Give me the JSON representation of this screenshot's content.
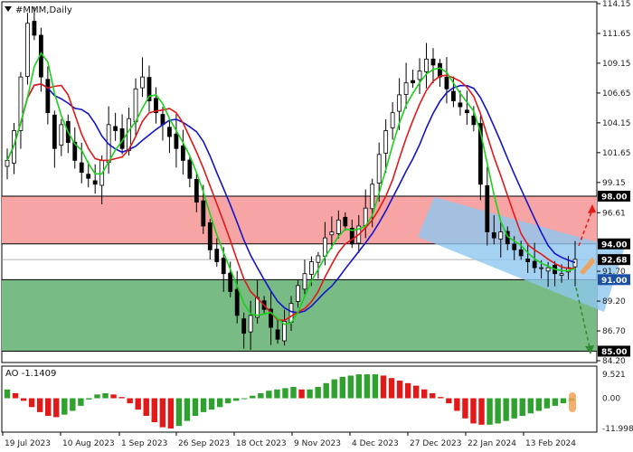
{
  "window": {
    "title": "#MMM,Daily",
    "collapse_icon": "triangle-down-icon"
  },
  "colors": {
    "bull": "#000000",
    "bear": "#000000",
    "ma_fast": "#19d219",
    "ma_mid": "#e11919",
    "ma_slow": "#1414c8",
    "zone_resistance": "#f7a4a4",
    "zone_support": "#78bb84",
    "channel": "#8fc7ef",
    "ao_up": "#2ea12e",
    "ao_down": "#e11919",
    "badge_black": "#000000",
    "badge_blue": "#1a4fa5",
    "marker_orange": "#f2a055"
  },
  "price_axis": {
    "labels": [
      "114.15",
      "111.65",
      "109.15",
      "106.65",
      "104.15",
      "101.65",
      "99.15",
      "96.61",
      "94.00",
      "92.68",
      "91.70",
      "91.00",
      "89.20",
      "86.70",
      "85.00",
      "84.20"
    ],
    "badges": [
      {
        "text": "98.00",
        "style": "black"
      },
      {
        "text": "94.00",
        "style": "black"
      },
      {
        "text": "92.68",
        "style": "black"
      },
      {
        "text": "91.00",
        "style": "blue"
      },
      {
        "text": "85.00",
        "style": "black"
      }
    ]
  },
  "levels": {
    "resistance_zone": [
      94.0,
      98.0
    ],
    "support_zone": [
      85.0,
      91.0
    ],
    "current": 92.68
  },
  "time_axis": {
    "labels": [
      "19 Jul 2023",
      "10 Aug 2023",
      "1 Sep 2023",
      "26 Sep 2023",
      "18 Oct 2023",
      "9 Nov 2023",
      "4 Dec 2023",
      "27 Dec 2023",
      "22 Jan 2024",
      "13 Feb 2024"
    ]
  },
  "ao_panel": {
    "title": "AO -1.1409",
    "axis": [
      "9.521",
      "0.00",
      "-11.998"
    ]
  },
  "chart_data": {
    "type": "candlestick",
    "symbol": "#MMM",
    "timeframe": "Daily",
    "close_path": [
      101.0,
      103.5,
      108.0,
      112.5,
      111.5,
      108.0,
      105.0,
      102.0,
      104.0,
      102.5,
      101.0,
      100.0,
      99.5,
      99.0,
      101.0,
      104.0,
      103.5,
      102.0,
      104.5,
      107.0,
      108.0,
      106.0,
      105.0,
      104.0,
      103.0,
      102.0,
      101.0,
      99.5,
      97.5,
      95.5,
      93.5,
      92.5,
      91.5,
      90.0,
      88.0,
      86.5,
      88.0,
      89.5,
      88.5,
      87.0,
      86.0,
      87.5,
      89.0,
      90.5,
      91.5,
      92.5,
      93.0,
      94.5,
      95.0,
      96.0,
      95.5,
      94.0,
      95.5,
      97.0,
      99.0,
      101.5,
      103.5,
      105.0,
      106.5,
      107.5,
      107.5,
      108.5,
      109.5,
      109.0,
      108.0,
      107.0,
      106.0,
      105.5,
      105.0,
      104.0,
      99.0,
      95.0,
      94.5,
      95.0,
      94.0,
      93.5,
      93.0,
      92.5,
      92.0,
      92.0,
      92.0,
      91.5,
      91.5,
      92.0,
      92.7
    ],
    "ao_values": [
      3.5,
      2.0,
      -1.0,
      -3.5,
      -5.5,
      -7.0,
      -7.5,
      -6.5,
      -5.0,
      -3.0,
      -0.5,
      1.5,
      2.0,
      1.5,
      0.5,
      -2.0,
      -4.5,
      -7.0,
      -9.5,
      -11.5,
      -12.0,
      -11.0,
      -9.0,
      -7.0,
      -5.5,
      -4.5,
      -3.5,
      -2.0,
      -1.0,
      0.0,
      1.0,
      2.0,
      3.0,
      3.5,
      4.0,
      4.5,
      3.5,
      3.5,
      4.5,
      6.0,
      7.5,
      8.5,
      9.0,
      9.5,
      9.5,
      9.5,
      9.0,
      8.0,
      7.0,
      6.0,
      5.0,
      3.5,
      2.0,
      0.5,
      -2.0,
      -5.0,
      -8.0,
      -10.0,
      -10.5,
      -10.5,
      -10.0,
      -9.0,
      -8.0,
      -7.0,
      -6.0,
      -5.0,
      -4.0,
      -3.0,
      -2.0,
      -1.1409
    ],
    "indicators": [
      "MA fast (green)",
      "MA mid (red)",
      "MA slow (blue)",
      "AO"
    ],
    "ylim": [
      84.2,
      114.15
    ],
    "ao_ylim": [
      -11.998,
      9.521
    ]
  }
}
